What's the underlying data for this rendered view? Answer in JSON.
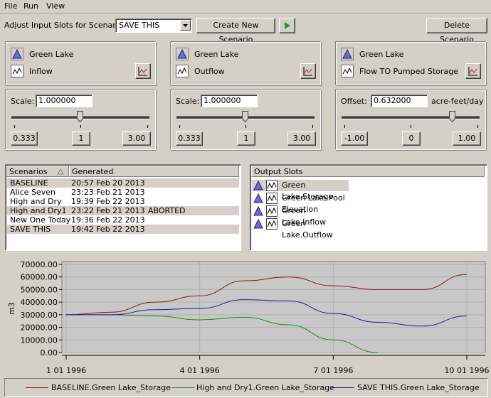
{
  "menu": [
    "File",
    "Run",
    "View"
  ],
  "toolbar": {
    "scenario_label": "Adjust Input Slots for Scenario:",
    "scenario_value": "SAVE THIS",
    "create_button": "Create New Scenario",
    "delete_button": "Delete Scenario"
  },
  "slots": [
    {
      "object": "Green Lake",
      "slot": "Inflow",
      "scale_label": "Scale:",
      "scale_value": "1.000000",
      "unit": "",
      "min": "0.333",
      "mid": "1",
      "max": "3.00",
      "level": 0.5
    },
    {
      "object": "Green Lake",
      "slot": "Outflow",
      "scale_label": "Scale:",
      "scale_value": "1.000000",
      "unit": "",
      "min": "0.333",
      "mid": "1",
      "max": "3.00",
      "level": 0.5
    },
    {
      "object": "Green Lake",
      "slot": "Flow TO Pumped Storage",
      "scale_label": "Offset:",
      "scale_value": "0.632000",
      "unit": "acre-feet/day",
      "min": "-1.00",
      "mid": "0",
      "max": "1.00",
      "level": 0.816
    }
  ],
  "scenarios": {
    "col1": "Scenarios",
    "col2": "Generated",
    "rows": [
      {
        "name": "BASELINE",
        "time": "20:57 Feb 20 2013",
        "status": "",
        "selected": true
      },
      {
        "name": "Alice Seven",
        "time": "23:23 Feb 21 2013",
        "status": "",
        "selected": false
      },
      {
        "name": "High and Dry",
        "time": "19:39 Feb 22 2013",
        "status": "",
        "selected": false
      },
      {
        "name": "High and Dry1",
        "time": "23:22 Feb 21 2013",
        "status": "ABORTED",
        "selected": true
      },
      {
        "name": "New One Today",
        "time": "19:36 Feb 22 2013",
        "status": "",
        "selected": false
      },
      {
        "name": "SAVE THIS",
        "time": "19:42 Feb 22 2013",
        "status": "",
        "selected": true
      }
    ]
  },
  "output_slots": {
    "header": "Output Slots",
    "items": [
      "Green Lake.Storage",
      "Green Lake.Pool Elevation",
      "Green Lake.Inflow",
      "Green Lake.Outflow"
    ]
  },
  "chart_data": {
    "type": "line",
    "ylabel": "m3",
    "ylim": [
      0,
      70000
    ],
    "yticks": [
      "70000.00",
      "60000.00",
      "50000.00",
      "40000.00",
      "30000.00",
      "20000.00",
      "10000.00",
      "0.00"
    ],
    "xticks": [
      "1 01 1996",
      "4 01 1996",
      "7 01 1996",
      "10 01 1996"
    ],
    "x": [
      "1996-01-01",
      "1996-02-01",
      "1996-03-01",
      "1996-04-01",
      "1996-05-01",
      "1996-06-01",
      "1996-07-01",
      "1996-08-01",
      "1996-09-01",
      "1996-10-01"
    ],
    "series": [
      {
        "name": "BASELINE.Green Lake_Storage",
        "color": "#8b1a1a",
        "values": [
          30000,
          32000,
          40000,
          45000,
          57000,
          60000,
          53000,
          50000,
          50000,
          62000
        ]
      },
      {
        "name": "High and Dry1.Green Lake_Storage",
        "color": "#1a8b1a",
        "values": [
          30000,
          30000,
          29000,
          26000,
          28000,
          22000,
          10000,
          0,
          null,
          null
        ]
      },
      {
        "name": "SAVE THIS.Green Lake_Storage",
        "color": "#1a1a9b",
        "values": [
          30000,
          30000,
          34000,
          35000,
          42000,
          41000,
          31000,
          24000,
          21000,
          29000
        ]
      }
    ]
  }
}
